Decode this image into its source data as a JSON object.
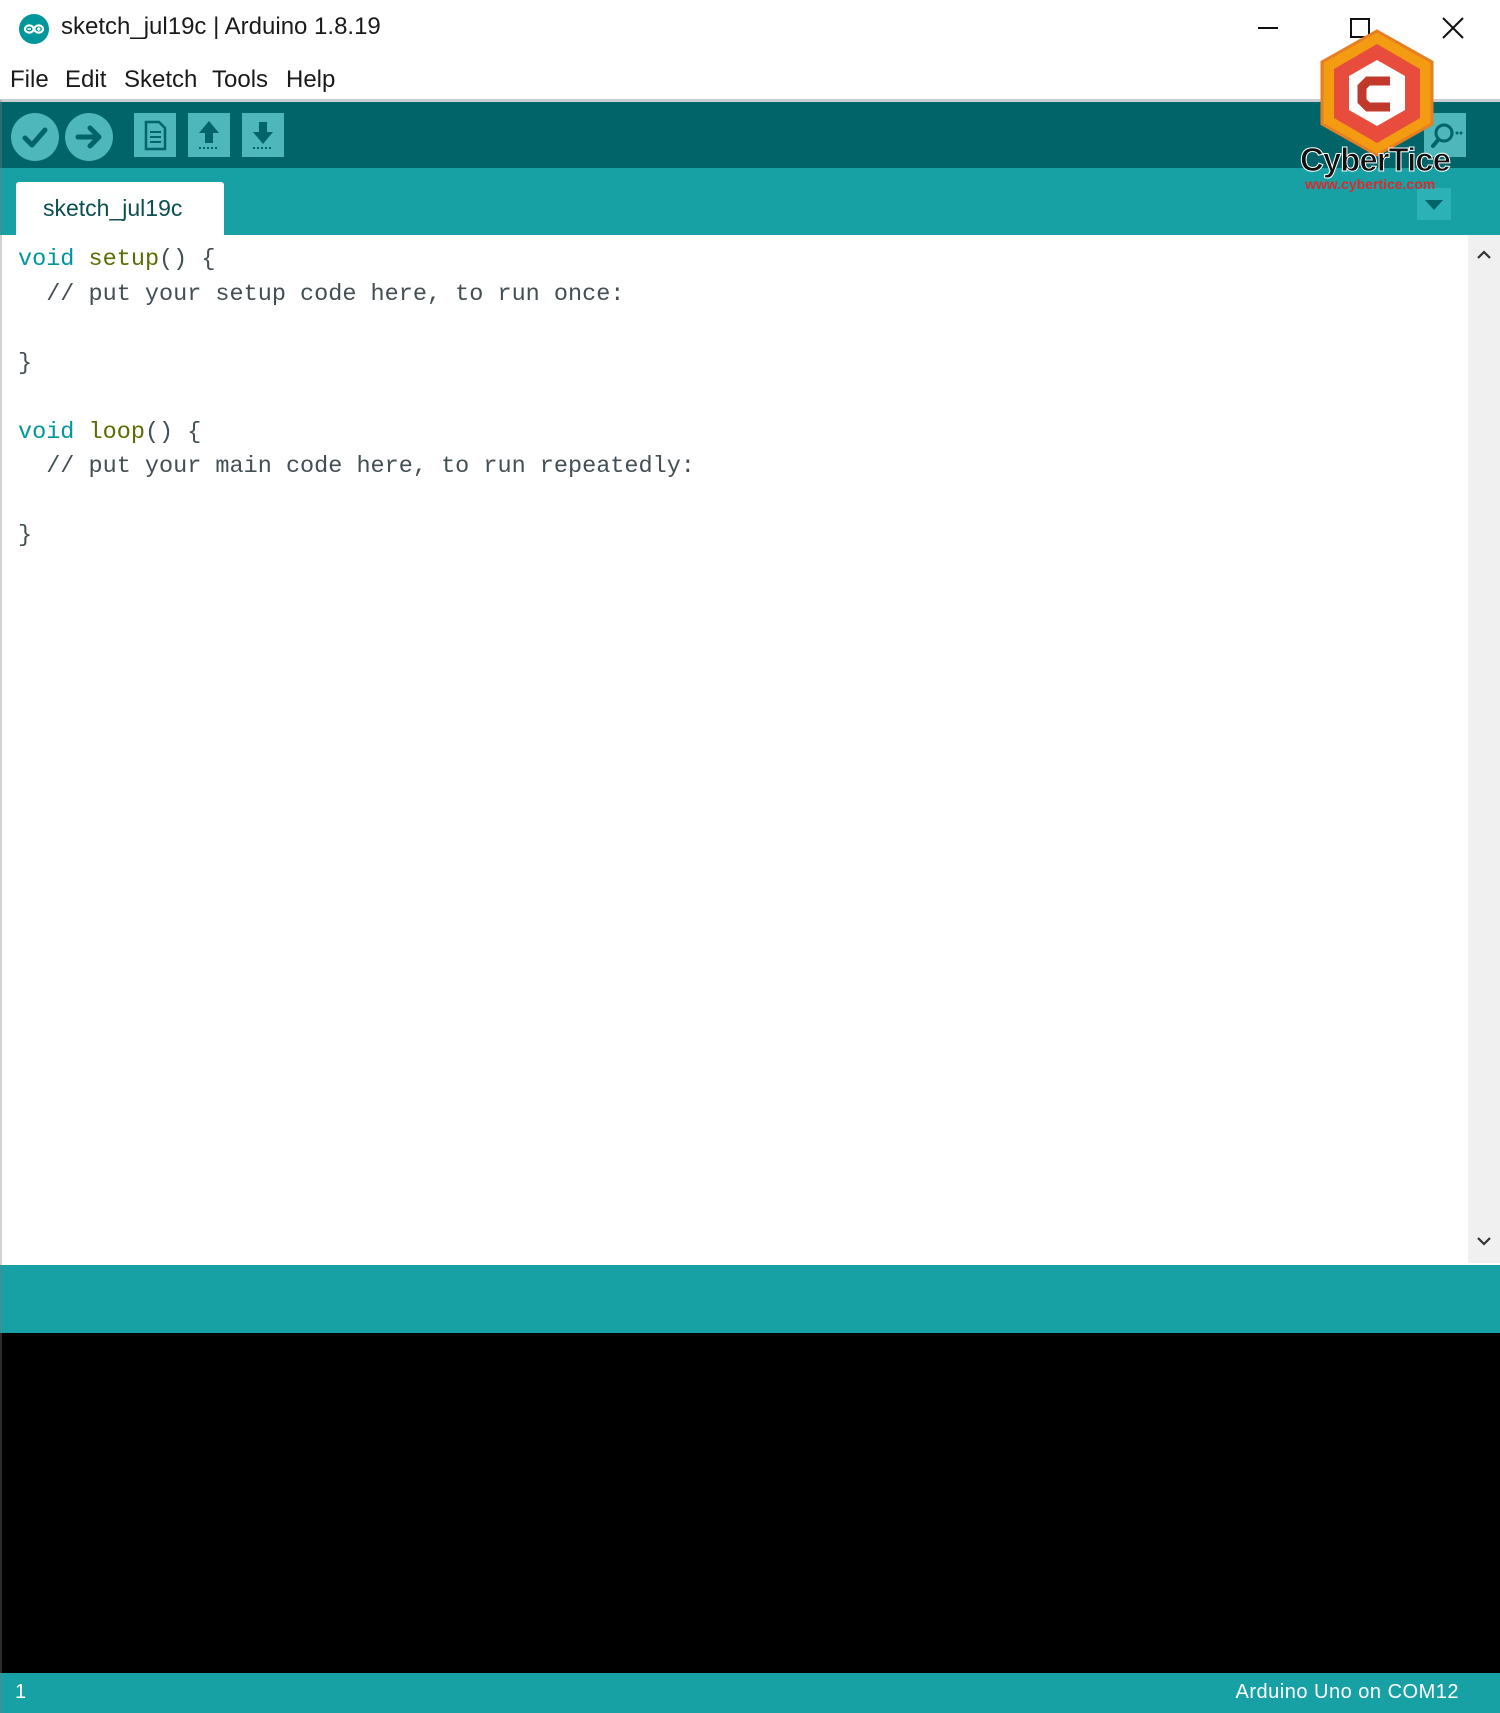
{
  "window": {
    "title": "sketch_jul19c | Arduino 1.8.19"
  },
  "menubar": {
    "items": [
      "File",
      "Edit",
      "Sketch",
      "Tools",
      "Help"
    ]
  },
  "toolbar": {
    "buttons": [
      {
        "name": "verify",
        "icon": "check-icon"
      },
      {
        "name": "upload",
        "icon": "arrow-right-icon"
      },
      {
        "name": "new",
        "icon": "document-icon"
      },
      {
        "name": "open",
        "icon": "arrow-up-icon"
      },
      {
        "name": "save",
        "icon": "arrow-down-icon"
      },
      {
        "name": "serial-monitor",
        "icon": "magnifier-icon"
      }
    ]
  },
  "tabs": [
    {
      "label": "sketch_jul19c"
    }
  ],
  "editor": {
    "lines": [
      {
        "kw": "void",
        "fn": "setup",
        "rest": "() {"
      },
      {
        "comment": "  // put your setup code here, to run once:"
      },
      {
        "plain": ""
      },
      {
        "plain": "}"
      },
      {
        "plain": ""
      },
      {
        "kw": "void",
        "fn": "loop",
        "rest": "() {"
      },
      {
        "comment": "  // put your main code here, to run repeatedly:"
      },
      {
        "plain": ""
      },
      {
        "plain": "}"
      }
    ]
  },
  "status": {
    "line_number": "1",
    "board": "Arduino Uno on COM12"
  },
  "watermark": {
    "brand": "CyberTice",
    "url": "www.cybertice.com"
  },
  "colors": {
    "toolbar": "#006468",
    "tabbar": "#17a1a5",
    "keyword": "#00979c",
    "function": "#5e6d03",
    "console": "#000000"
  }
}
